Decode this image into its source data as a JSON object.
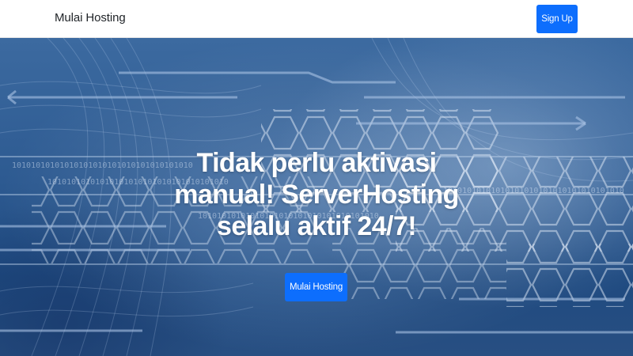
{
  "navbar": {
    "brand": "Mulai Hosting",
    "signup_label": "Sign Up"
  },
  "hero": {
    "headline_line1": "Tidak perlu aktivasi",
    "headline_line2": "manual! ServerHosting",
    "headline_line3": "selalu aktif 24/7!",
    "cta_label": "Mulai Hosting",
    "binary_text": "10101010101010101010101010101010101010"
  },
  "colors": {
    "accent": "#0d6efd",
    "hero_base": "#2d5a91",
    "text_light": "#ffffff",
    "text_dark": "#212529"
  }
}
